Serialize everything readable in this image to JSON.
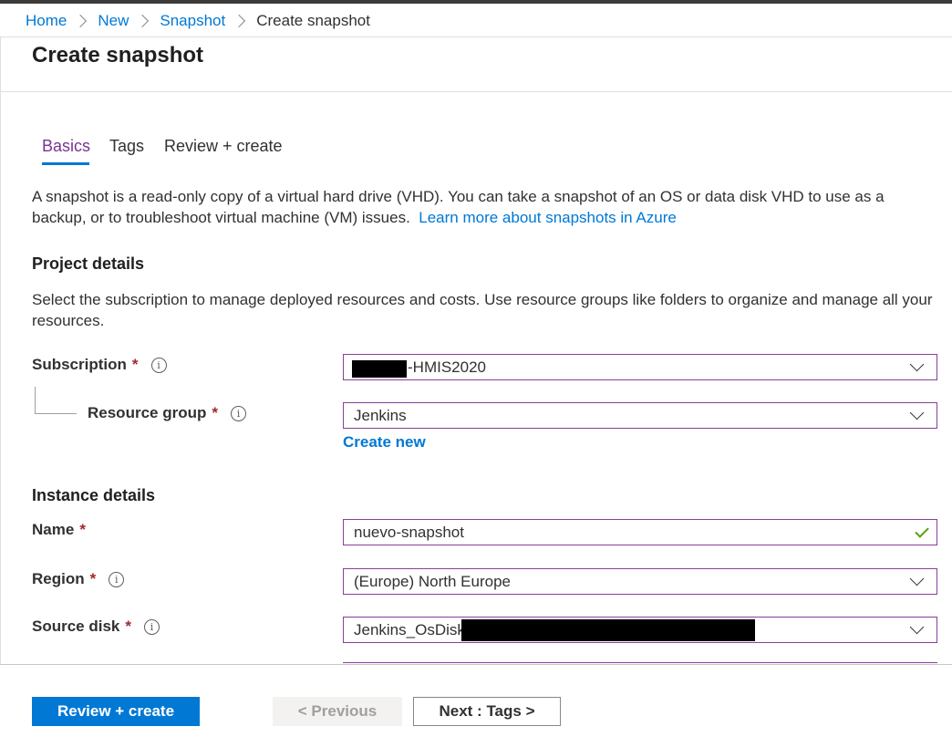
{
  "breadcrumb": {
    "items": [
      "Home",
      "New",
      "Snapshot"
    ],
    "current": "Create snapshot"
  },
  "page": {
    "title": "Create snapshot"
  },
  "tabs": [
    {
      "label": "Basics",
      "active": true
    },
    {
      "label": "Tags",
      "active": false
    },
    {
      "label": "Review + create",
      "active": false
    }
  ],
  "intro": {
    "text": "A snapshot is a read-only copy of a virtual hard drive (VHD). You can take a snapshot of an OS or data disk VHD to use as a backup, or to troubleshoot virtual machine (VM) issues.",
    "link": "Learn more about snapshots in Azure"
  },
  "project_details": {
    "heading": "Project details",
    "description": "Select the subscription to manage deployed resources and costs. Use resource groups like folders to organize and manage all your resources.",
    "subscription": {
      "label": "Subscription",
      "value": "-HMIS2020"
    },
    "resource_group": {
      "label": "Resource group",
      "value": "Jenkins",
      "create_new": "Create new"
    }
  },
  "instance_details": {
    "heading": "Instance details",
    "name": {
      "label": "Name",
      "value": "nuevo-snapshot"
    },
    "region": {
      "label": "Region",
      "value": "(Europe) North Europe"
    },
    "source_disk": {
      "label": "Source disk",
      "value": "Jenkins_OsDisk"
    }
  },
  "required_marker": "*",
  "info_glyph": "i",
  "footer": {
    "review_create": "Review + create",
    "previous": "< Previous",
    "next": "Next : Tags >"
  },
  "colors": {
    "accent": "#0078d4",
    "active_tab": "#7a3292",
    "field_border": "#8a3e9b",
    "required": "#a4262c",
    "valid_check": "#57a300"
  }
}
